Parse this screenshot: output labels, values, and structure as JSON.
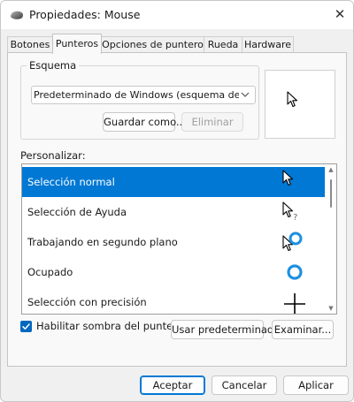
{
  "window": {
    "title": "Propiedades: Mouse",
    "close_glyph": "✕",
    "title_icon": "mouse-icon"
  },
  "tabs": [
    {
      "label": "Botones",
      "active": false
    },
    {
      "label": "Punteros",
      "active": true
    },
    {
      "label": "Opciones de puntero",
      "active": false
    },
    {
      "label": "Rueda",
      "active": false
    },
    {
      "label": "Hardware",
      "active": false
    }
  ],
  "scheme": {
    "label": "Esquema",
    "selected": "Predeterminado de Windows (esquema de sistema)",
    "save_as_label": "Guardar como...",
    "delete_label": "Eliminar"
  },
  "customize": {
    "label": "Personalizar:",
    "items": [
      {
        "label": "Selección normal",
        "icon": "arrow-pointer-icon",
        "selected": true
      },
      {
        "label": "Selección de Ayuda",
        "icon": "help-select-icon",
        "selected": false
      },
      {
        "label": "Trabajando en segundo plano",
        "icon": "working-in-background-icon",
        "selected": false
      },
      {
        "label": "Ocupado",
        "icon": "busy-ring-icon",
        "selected": false
      },
      {
        "label": "Selección con precisión",
        "icon": "crosshair-icon",
        "selected": false
      }
    ]
  },
  "shadow": {
    "label": "Habilitar sombra del puntero",
    "checked": true
  },
  "buttons": {
    "use_default": "Usar predeterminado",
    "browse": "Examinar...",
    "ok": "Aceptar",
    "cancel": "Cancelar",
    "apply": "Aplicar"
  },
  "colors": {
    "accent": "#0078d4",
    "checkbox": "#0067c0",
    "busy_ring": "#1e90e0"
  }
}
